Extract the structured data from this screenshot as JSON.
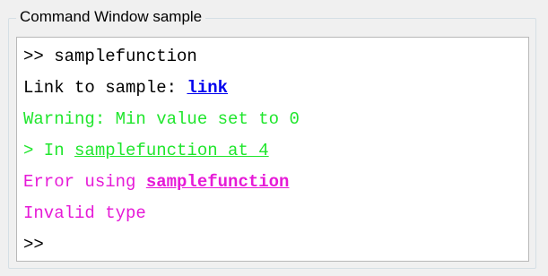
{
  "window": {
    "title": "Command Window sample"
  },
  "console": {
    "line1": ">> samplefunction",
    "line2_prefix": "Link to sample: ",
    "line2_link": "link",
    "line3": "Warning: Min value set to 0",
    "line4_prefix": "> In ",
    "line4_link": "samplefunction at 4",
    "line5_prefix": "Error using ",
    "line5_link": "samplefunction",
    "line6": "Invalid type",
    "line7_prompt": ">>"
  },
  "colors": {
    "normal_text": "#000000",
    "hyperlink": "#0000ee",
    "warning": "#20e62d",
    "error": "#e61ad7",
    "console_background": "#ffffff",
    "panel_background": "#f0f0f0"
  }
}
